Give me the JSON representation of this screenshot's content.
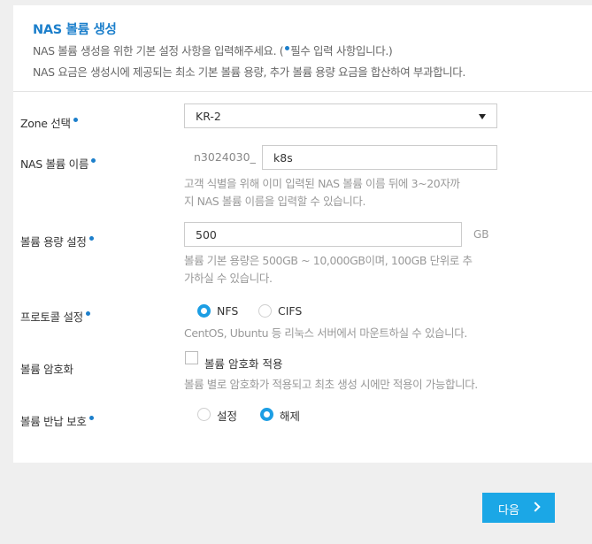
{
  "header": {
    "title": "NAS 볼륨 생성",
    "desc1_before": "NAS 볼륨 생성을 위한 기본 설정 사항을 입력해주세요. (",
    "desc1_after": "필수 입력 사항입니다.)",
    "desc2": "NAS 요금은 생성시에 제공되는 최소 기본 볼륨 용량, 추가 볼륨 용량 요금을 합산하여 부과합니다."
  },
  "zone": {
    "label": "Zone 선택",
    "value": "KR-2"
  },
  "volume_name": {
    "label": "NAS 볼륨 이름",
    "prefix": "n3024030_",
    "value": "k8s",
    "help_line1": "고객 식별을 위해 이미 입력된 NAS 볼륨 이름 뒤에 3~20자까",
    "help_line2": "지 NAS 볼륨 이름을 입력할 수 있습니다."
  },
  "capacity": {
    "label": "볼륨 용량 설정",
    "value": "500",
    "unit": "GB",
    "help_line1": "볼륨 기본 용량은 500GB ~ 10,000GB이며, 100GB 단위로 추",
    "help_line2": "가하실 수 있습니다."
  },
  "protocol": {
    "label": "프로토콜 설정",
    "options": [
      "NFS",
      "CIFS"
    ],
    "selected": "NFS",
    "help": "CentOS, Ubuntu 등 리눅스 서버에서 마운트하실 수 있습니다."
  },
  "encryption": {
    "label": "볼륨 암호화",
    "checkbox_label": "볼륨 암호화 적용",
    "checked": false,
    "help": "볼륨 별로 암호화가 적용되고 최초 생성 시에만 적용이 가능합니다."
  },
  "return_protection": {
    "label": "볼륨 반납 보호",
    "options": [
      "설정",
      "해제"
    ],
    "selected": "해제"
  },
  "footer": {
    "next_label": "다음"
  },
  "colors": {
    "accent": "#1c7fcb",
    "button": "#1ba7e6"
  },
  "icons": {
    "select_caret": "caret-down-icon",
    "next_arrow": "chevron-right-icon"
  }
}
